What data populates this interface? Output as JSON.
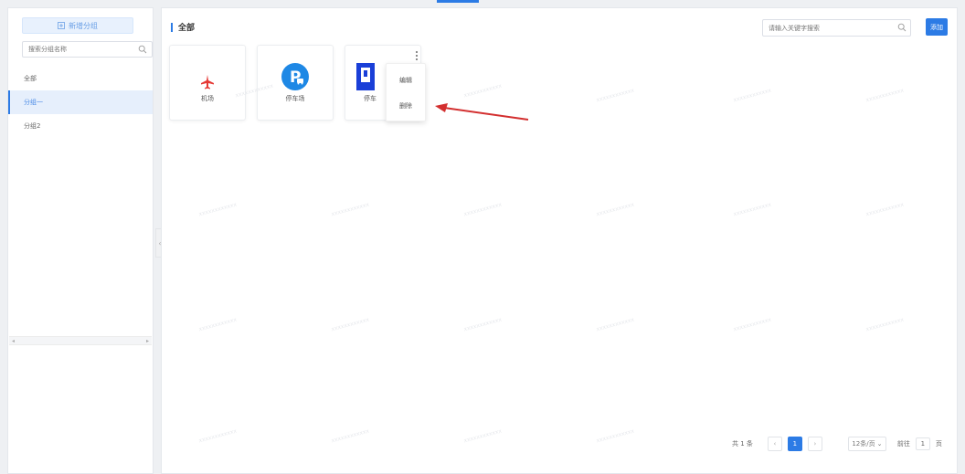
{
  "sidebar": {
    "add_group_label": "新增分组",
    "search_placeholder": "搜索分组名称",
    "groups": [
      {
        "label": "全部"
      },
      {
        "label": "分组一"
      },
      {
        "label": "分组2"
      }
    ],
    "active_index": 1
  },
  "main": {
    "title": "全部",
    "search_placeholder": "请输入关键字搜索",
    "add_label": "添加",
    "cards": [
      {
        "label": "机场",
        "icon": "airplane-icon"
      },
      {
        "label": "停车场",
        "icon": "parking-icon"
      },
      {
        "label": "停车",
        "icon": "parking-sign-icon"
      }
    ],
    "context_menu": [
      "编辑",
      "删除"
    ],
    "watermark_text": "xxxxxxxxxxxx"
  },
  "pagination": {
    "total": "共 1 条",
    "current_page": "1",
    "page_size": "12条/页",
    "jump_label": "前往",
    "jump_value": "1",
    "page_suffix": "页"
  },
  "colors": {
    "accent": "#2c7be5",
    "airplane": "#e53935",
    "parking": "#1e88e5",
    "annotation_arrow": "#d32f2f"
  }
}
